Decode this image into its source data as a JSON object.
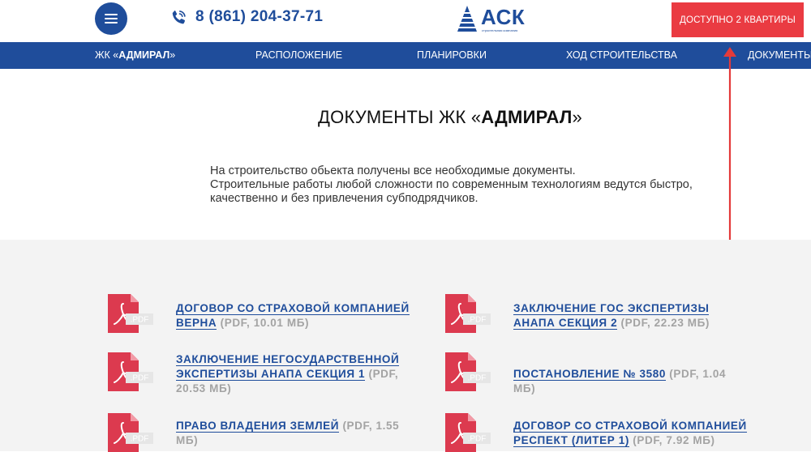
{
  "header": {
    "phone": "8 (861) 204-37-71",
    "logo": {
      "name": "АСК",
      "tagline": "строительная компания"
    },
    "cta_label": "ДОСТУПНО 2 КВАРТИРЫ"
  },
  "nav": {
    "items": [
      {
        "prefix": "ЖК «",
        "bold": "АДМИРАЛ",
        "suffix": "»"
      },
      {
        "label": "РАСПОЛОЖЕНИЕ"
      },
      {
        "label": "ПЛАНИРОВКИ"
      },
      {
        "label": "ХОД СТРОИТЕЛЬСТВА"
      },
      {
        "label": "ДОКУМЕНТЫ"
      }
    ]
  },
  "page": {
    "title_prefix": "ДОКУМЕНТЫ ЖК «",
    "title_bold": "АДМИРАЛ",
    "title_suffix": "»",
    "intro": [
      "На строительство обьекта получены все необходимые документы.",
      "Строительные работы любой сложности по современным технологиям ведутся быстро,",
      "качественно и без привлечения субподрядчиков."
    ]
  },
  "documents": [
    {
      "title": "Договор со страховой компанией Верна",
      "meta": " (PDF, 10.01 МБ)"
    },
    {
      "title": "Заключение ГОС экспертизы Анапа секция 2",
      "meta": " (PDF, 22.23 МБ)"
    },
    {
      "title": "Заключение негосударственной экспертизы Анапа секция 1",
      "meta": " (PDF, 20.53 МБ)"
    },
    {
      "title": "Постановление № 3580",
      "meta": " (PDF, 1.04 МБ)"
    },
    {
      "title": "Право владения землей",
      "meta": " (PDF, 1.55 МБ)"
    },
    {
      "title": "Договор со страховой компанией Респект (Литер 1)",
      "meta": " (PDF, 7.92 МБ)"
    }
  ],
  "pdf_badge": ".PDF",
  "colors": {
    "brand_blue": "#1f4d9b",
    "accent_red": "#ea3b42",
    "pdf_red": "#dc3a4f",
    "section_bg": "#f3f3f3"
  },
  "icons": {
    "menu": "hamburger-icon",
    "phone": "phone-icon",
    "document": "pdf-document-icon"
  }
}
